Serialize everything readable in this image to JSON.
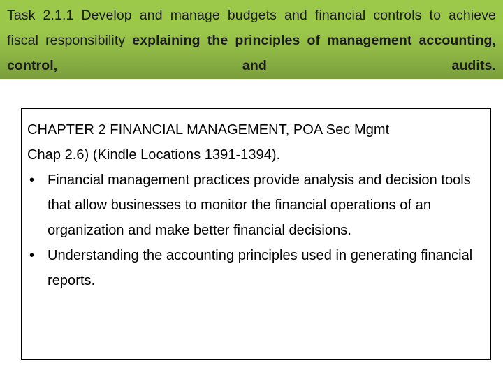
{
  "slide": {
    "banner": {
      "lead_text": "Task 2.1.1 Develop and manage budgets and financial controls to achieve fiscal responsibility ",
      "emphasis_text": "explaining the principles of management accounting, control, and audits.",
      "gradient_top_color": "#9DC94B",
      "gradient_bottom_color": "#7A9E3C",
      "text_color": "#1b1b1b"
    },
    "content_box": {
      "border_color": "#000000",
      "background_color": "#ffffff",
      "source_line_1": "CHAPTER 2 FINANCIAL MANAGEMENT, POA Sec Mgmt",
      "source_line_2": "Chap 2.6) (Kindle Locations 1391-1394).",
      "bullets": [
        {
          "glyph": "bullet-point",
          "marker": "•",
          "text": "Financial management practices provide analysis and decision tools that allow businesses to monitor the financial operations of an organization and make better financial decisions."
        },
        {
          "glyph": "bullet-point",
          "marker": "•",
          "text": "Understanding the accounting principles used in generating financial reports."
        }
      ]
    }
  }
}
